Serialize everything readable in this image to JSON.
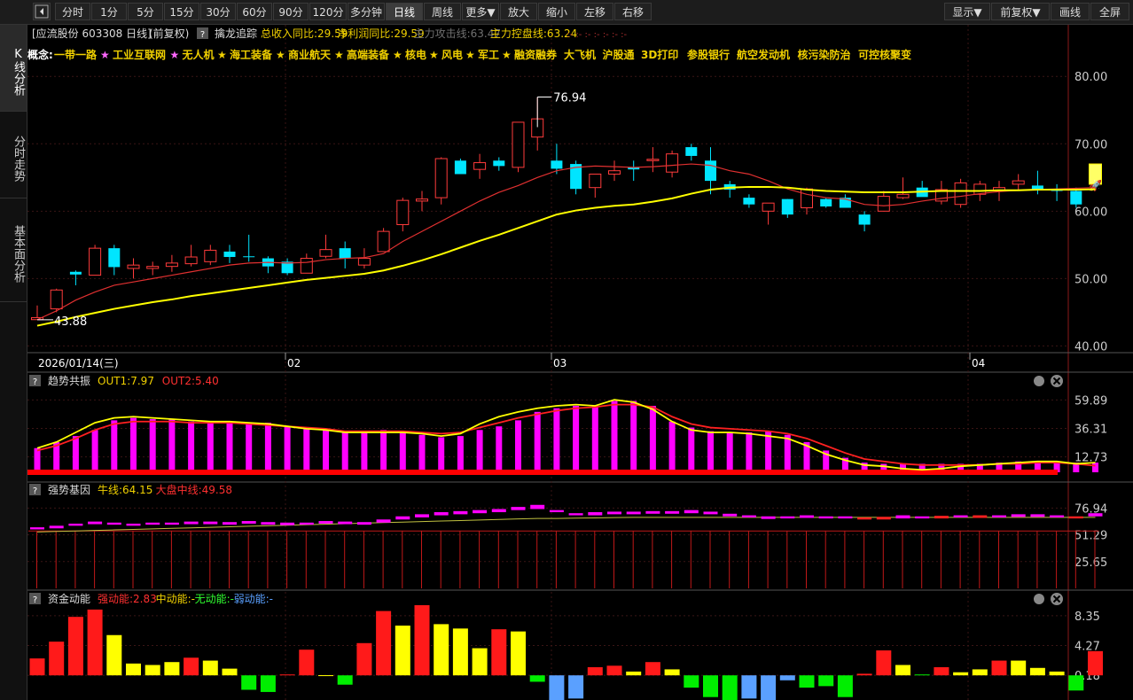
{
  "toolbar": {
    "back_icon": "back-arrow-icon",
    "left_buttons": [
      {
        "label": "分时",
        "w": 40
      },
      {
        "label": "1分",
        "w": 40
      },
      {
        "label": "5分",
        "w": 40
      },
      {
        "label": "15分",
        "w": 40
      },
      {
        "label": "30分",
        "w": 40
      },
      {
        "label": "60分",
        "w": 40
      },
      {
        "label": "90分",
        "w": 40
      },
      {
        "label": "120分",
        "w": 42
      },
      {
        "label": "多分钟",
        "w": 42
      },
      {
        "label": "日线",
        "w": 42,
        "active": true
      },
      {
        "label": "周线",
        "w": 42
      },
      {
        "label": "更多▼",
        "w": 42
      },
      {
        "label": "放大",
        "w": 42
      },
      {
        "label": "缩小",
        "w": 42
      },
      {
        "label": "左移",
        "w": 42
      },
      {
        "label": "右移",
        "w": 42
      }
    ],
    "right_buttons": [
      {
        "label": "显示▼",
        "w": 52
      },
      {
        "label": "前复权▼",
        "w": 66
      },
      {
        "label": "画线",
        "w": 44
      },
      {
        "label": "全屏",
        "w": 44
      }
    ]
  },
  "sidebar": [
    {
      "label": "K线分析",
      "active": true
    },
    {
      "label": "分时走势",
      "active": false
    },
    {
      "label": "基本面分析",
      "active": false
    }
  ],
  "main": {
    "title": "[应流股份 603308 日线]",
    "fq": "(前复权)",
    "indicator_name": "擒龙追踪",
    "metrics": [
      {
        "text": "总收入同比:29.59",
        "color": "#f0d000"
      },
      {
        "text": "净利润同比:29.59",
        "color": "#f0d000"
      },
      {
        "text": "主力攻击线:63.47",
        "color": "#707070"
      },
      {
        "text": "主力控盘线:63.24",
        "color": "#f0d000"
      }
    ],
    "trailing_marks": ":- :- :- :- :- :- :-",
    "concept_label": "概念:",
    "concepts": [
      {
        "name": "一带一路",
        "mark": "★",
        "mark_color": "#ff66ff"
      },
      {
        "name": "工业互联网",
        "mark": "★",
        "mark_color": "#ff66ff"
      },
      {
        "name": "无人机",
        "mark": "★",
        "mark_color": "#f0d000"
      },
      {
        "name": "海工装备",
        "mark": "★",
        "mark_color": "#f0d000"
      },
      {
        "name": "商业航天",
        "mark": "★",
        "mark_color": "#f0d000"
      },
      {
        "name": "高端装备",
        "mark": "★",
        "mark_color": "#f0d000"
      },
      {
        "name": "核电",
        "mark": "★",
        "mark_color": "#f0d000"
      },
      {
        "name": "风电",
        "mark": "★",
        "mark_color": "#f0d000"
      },
      {
        "name": "军工",
        "mark": "★",
        "mark_color": "#f0d000"
      },
      {
        "name": "融资融券",
        "mark": ""
      },
      {
        "name": "大飞机",
        "mark": ""
      },
      {
        "name": "沪股通",
        "mark": ""
      },
      {
        "name": "3D打印",
        "mark": ""
      },
      {
        "name": "参股银行",
        "mark": ""
      },
      {
        "name": "航空发动机",
        "mark": ""
      },
      {
        "name": "核污染防治",
        "mark": ""
      },
      {
        "name": "可控核聚变",
        "mark": ""
      }
    ],
    "high_label": "76.94",
    "low_label": "43.88",
    "date_label": "2026/01/14(三)",
    "month_labels": [
      "02",
      "03",
      "04"
    ]
  },
  "chart_data": {
    "type": "candlestick",
    "ylim": [
      39,
      87
    ],
    "y_ticks": [
      "80.00",
      "70.00",
      "60.00",
      "50.00",
      "40.00"
    ],
    "candles": [
      [
        43.9,
        46.0,
        43.9,
        44.2
      ],
      [
        45.5,
        48.5,
        45.0,
        48.3
      ],
      [
        51.0,
        51.2,
        49.0,
        50.6
      ],
      [
        50.5,
        55.0,
        50.5,
        54.5
      ],
      [
        54.5,
        55.0,
        50.5,
        51.7
      ],
      [
        51.5,
        53.0,
        50.0,
        52.0
      ],
      [
        51.5,
        52.5,
        50.5,
        51.8
      ],
      [
        51.8,
        53.5,
        51.0,
        52.3
      ],
      [
        52.2,
        55.0,
        51.8,
        53.2
      ],
      [
        52.5,
        55.0,
        52.0,
        54.2
      ],
      [
        54.0,
        55.0,
        52.3,
        53.2
      ],
      [
        53.3,
        56.5,
        52.5,
        53.2
      ],
      [
        53.0,
        53.3,
        50.8,
        51.8
      ],
      [
        52.5,
        53.0,
        50.5,
        50.8
      ],
      [
        50.8,
        53.7,
        50.8,
        53.0
      ],
      [
        53.3,
        56.5,
        53.0,
        54.3
      ],
      [
        54.5,
        55.5,
        51.5,
        53.0
      ],
      [
        52.0,
        54.5,
        51.5,
        53.0
      ],
      [
        54.0,
        57.5,
        54.0,
        57.0
      ],
      [
        58.0,
        62.0,
        57.0,
        61.6
      ],
      [
        61.5,
        63.0,
        60.0,
        61.8
      ],
      [
        62.0,
        68.0,
        61.0,
        67.8
      ],
      [
        67.5,
        67.8,
        65.5,
        65.5
      ],
      [
        66.2,
        68.5,
        64.8,
        67.2
      ],
      [
        67.5,
        68.0,
        66.0,
        66.7
      ],
      [
        66.5,
        72.5,
        65.8,
        73.2
      ],
      [
        71.0,
        76.9,
        69.0,
        73.7
      ],
      [
        67.5,
        70.0,
        65.5,
        66.3
      ],
      [
        67.0,
        67.5,
        62.5,
        63.3
      ],
      [
        63.5,
        65.5,
        62.0,
        65.5
      ],
      [
        65.5,
        67.5,
        64.5,
        66.0
      ],
      [
        66.5,
        67.5,
        64.5,
        66.2
      ],
      [
        67.5,
        69.5,
        65.8,
        67.7
      ],
      [
        65.8,
        69.0,
        65.0,
        68.5
      ],
      [
        69.5,
        70.0,
        67.5,
        68.2
      ],
      [
        67.5,
        69.5,
        62.5,
        64.5
      ],
      [
        64.0,
        64.5,
        62.0,
        63.2
      ],
      [
        62.0,
        62.5,
        60.5,
        61.0
      ],
      [
        60.0,
        60.5,
        58.0,
        61.2
      ],
      [
        61.8,
        61.8,
        59.0,
        59.5
      ],
      [
        60.5,
        63.5,
        59.5,
        63.3
      ],
      [
        61.8,
        62.0,
        60.5,
        60.7
      ],
      [
        62.0,
        62.5,
        60.5,
        60.5
      ],
      [
        59.5,
        60.0,
        57.0,
        58.0
      ],
      [
        60.0,
        63.0,
        60.0,
        62.2
      ],
      [
        62.0,
        65.0,
        61.8,
        62.5
      ],
      [
        63.5,
        64.5,
        62.5,
        62.1
      ],
      [
        61.5,
        64.5,
        61.0,
        63.2
      ],
      [
        61.0,
        64.8,
        60.5,
        64.2
      ],
      [
        62.5,
        64.5,
        61.5,
        64.0
      ],
      [
        63.0,
        64.5,
        61.5,
        63.5
      ],
      [
        64.0,
        65.5,
        63.0,
        64.5
      ],
      [
        63.8,
        66.0,
        62.5,
        63.2
      ],
      [
        63.3,
        64.0,
        61.5,
        63.0
      ],
      [
        63.0,
        63.5,
        60.5,
        61.0
      ],
      [
        64.0,
        67.0,
        63.5,
        67.0
      ]
    ],
    "ma_fast": [
      43.9,
      45.2,
      46.8,
      48.0,
      49.0,
      49.5,
      50.0,
      50.5,
      51.0,
      51.5,
      52.0,
      52.3,
      52.4,
      52.3,
      52.4,
      52.8,
      53.0,
      53.1,
      53.7,
      55.5,
      57.0,
      58.5,
      60.0,
      61.5,
      62.8,
      63.8,
      65.0,
      66.0,
      66.5,
      66.7,
      66.6,
      66.5,
      66.6,
      66.8,
      67.0,
      66.8,
      66.0,
      65.5,
      64.5,
      63.3,
      62.5,
      62.0,
      61.8,
      61.0,
      60.8,
      61.0,
      61.5,
      61.9,
      62.2,
      62.6,
      62.9,
      63.1,
      63.2,
      63.3,
      63.4,
      63.5
    ],
    "ma_slow": [
      43.0,
      43.6,
      44.3,
      44.9,
      45.5,
      46.0,
      46.5,
      46.9,
      47.4,
      47.8,
      48.2,
      48.6,
      49.0,
      49.4,
      49.8,
      50.1,
      50.4,
      50.7,
      51.2,
      51.9,
      52.7,
      53.6,
      54.6,
      55.6,
      56.5,
      57.5,
      58.5,
      59.5,
      60.1,
      60.5,
      60.8,
      61.0,
      61.4,
      61.9,
      62.6,
      63.2,
      63.5,
      63.6,
      63.6,
      63.5,
      63.2,
      63.0,
      62.9,
      62.8,
      62.8,
      62.8,
      62.9,
      63.0,
      63.0,
      63.0,
      63.1,
      63.1,
      63.2,
      63.2,
      63.2,
      63.24
    ],
    "sub1": {
      "name": "趋势共振",
      "out1": "OUT1:7.97",
      "out2": "OUT2:5.40",
      "ticks": [
        "59.89",
        "36.31",
        "12.73"
      ],
      "ylim": [
        0,
        66
      ],
      "bars": [
        20,
        25,
        30,
        35,
        43,
        45,
        44,
        44,
        42,
        42,
        42,
        41,
        41,
        38,
        37,
        36,
        33,
        33,
        35,
        33,
        31,
        29,
        30,
        35,
        38,
        43,
        50,
        53,
        55,
        55,
        59,
        59,
        55,
        42,
        37,
        34,
        33,
        33,
        34,
        31,
        25,
        18,
        12,
        8,
        7,
        7,
        7,
        7,
        7,
        7,
        8,
        9,
        9,
        9,
        8,
        8
      ],
      "line_out1": [
        20,
        25,
        33,
        41,
        45,
        46,
        45,
        44,
        43,
        42,
        42,
        41,
        40,
        38,
        36,
        35,
        33,
        33,
        33,
        33,
        32,
        30,
        32,
        40,
        46,
        50,
        53,
        55,
        56,
        55,
        60,
        58,
        52,
        42,
        35,
        33,
        33,
        32,
        30,
        28,
        22,
        15,
        10,
        6,
        5,
        3,
        2,
        3,
        5,
        6,
        7,
        8,
        9,
        9,
        7,
        7.97
      ],
      "line_out2": [
        18,
        22,
        28,
        35,
        40,
        42,
        42,
        42,
        41,
        41,
        41,
        40,
        39,
        38,
        37,
        36,
        34,
        34,
        34,
        34,
        33,
        32,
        33,
        37,
        41,
        45,
        48,
        51,
        53,
        54,
        56,
        56,
        54,
        46,
        40,
        37,
        36,
        35,
        34,
        32,
        28,
        22,
        16,
        11,
        9,
        7,
        6,
        6,
        6,
        6,
        7,
        7,
        8,
        8,
        7,
        5.4
      ]
    },
    "sub2": {
      "name": "强势基因",
      "niu": "牛线:64.15",
      "dapan": "大盘中线:49.58",
      "ticks": [
        "76.94",
        "51.29",
        "25.65"
      ],
      "ylim": [
        0,
        90
      ],
      "boxes": [
        [
          56.5,
          58.5
        ],
        [
          57.5,
          60
        ],
        [
          60,
          62
        ],
        [
          61.5,
          64
        ],
        [
          61,
          63
        ],
        [
          60,
          62
        ],
        [
          61,
          63
        ],
        [
          61,
          63
        ],
        [
          61.5,
          64
        ],
        [
          61.5,
          64
        ],
        [
          61,
          63.5
        ],
        [
          62,
          64.5
        ],
        [
          61,
          63.5
        ],
        [
          60.5,
          63
        ],
        [
          61,
          63
        ],
        [
          62,
          64.5
        ],
        [
          61.5,
          64
        ],
        [
          61,
          63.5
        ],
        [
          63,
          66
        ],
        [
          66,
          69
        ],
        [
          68,
          71
        ],
        [
          70,
          73
        ],
        [
          71,
          74
        ],
        [
          72,
          75
        ],
        [
          73,
          76
        ],
        [
          75,
          78
        ],
        [
          76,
          80
        ],
        [
          73,
          75
        ],
        [
          70,
          72
        ],
        [
          70,
          73
        ],
        [
          71,
          73.5
        ],
        [
          71,
          73.5
        ],
        [
          71.5,
          74
        ],
        [
          71.5,
          74
        ],
        [
          72,
          75
        ],
        [
          71,
          73.5
        ],
        [
          69,
          71.5
        ],
        [
          68,
          70
        ],
        [
          66.5,
          69
        ],
        [
          67,
          69
        ],
        [
          67.5,
          70
        ],
        [
          67,
          69
        ],
        [
          67,
          69
        ],
        [
          66,
          68
        ],
        [
          66,
          68.5
        ],
        [
          67,
          70
        ],
        [
          67,
          69
        ],
        [
          67,
          69.5
        ],
        [
          68,
          70
        ],
        [
          67.5,
          70
        ],
        [
          68,
          70
        ],
        [
          68.5,
          71
        ],
        [
          68.5,
          71
        ],
        [
          68,
          70
        ],
        [
          67,
          69
        ],
        [
          69,
          72
        ]
      ],
      "boxcolor": [
        "p",
        "p",
        "p",
        "p",
        "p",
        "p",
        "p",
        "p",
        "p",
        "p",
        "p",
        "p",
        "p",
        "p",
        "p",
        "p",
        "p",
        "p",
        "p",
        "p",
        "p",
        "p",
        "p",
        "p",
        "p",
        "p",
        "p",
        "p",
        "p",
        "p",
        "p",
        "p",
        "p",
        "p",
        "p",
        "p",
        "p",
        "p",
        "p",
        "p",
        "p",
        "p",
        "p",
        "r",
        "r",
        "p",
        "p",
        "r",
        "p",
        "r",
        "p",
        "p",
        "p",
        "p",
        "r",
        "p"
      ],
      "niu_line": [
        54,
        54.5,
        55,
        55.5,
        56,
        56.5,
        57,
        57.5,
        58,
        58.5,
        59,
        59.5,
        60,
        60.5,
        61,
        61.5,
        62,
        62.5,
        63,
        63.5,
        64,
        64.5,
        65,
        65.5,
        66,
        66.5,
        67,
        67,
        67.3,
        67.5,
        67.8,
        68,
        68,
        68,
        68,
        68,
        68,
        68,
        68,
        68,
        68,
        68,
        68,
        68,
        68,
        68,
        68,
        68,
        68,
        68,
        68,
        68,
        68,
        68,
        68,
        68
      ],
      "red_line": 55
    },
    "sub3": {
      "name": "资金动能",
      "strong": "强动能:2.83",
      "mid": "中动能:-",
      "none": "无动能:-",
      "weak": "弱动能:-",
      "ticks": [
        "8.35",
        "4.27",
        "0.18"
      ],
      "ylim": [
        -3.2,
        9.8
      ],
      "bars": [
        [
          2.5,
          "r"
        ],
        [
          4.8,
          "r"
        ],
        [
          8.2,
          "r"
        ],
        [
          9.2,
          "r"
        ],
        [
          5.7,
          "y"
        ],
        [
          1.8,
          "y"
        ],
        [
          1.6,
          "y"
        ],
        [
          2.0,
          "y"
        ],
        [
          2.6,
          "r"
        ],
        [
          2.2,
          "y"
        ],
        [
          1.1,
          "y"
        ],
        [
          -1.8,
          "g"
        ],
        [
          -2.1,
          "g"
        ],
        [
          0.3,
          "r"
        ],
        [
          3.7,
          "r"
        ],
        [
          0.2,
          "y"
        ],
        [
          -1.1,
          "g"
        ],
        [
          4.6,
          "r"
        ],
        [
          9.0,
          "r"
        ],
        [
          7.0,
          "y"
        ],
        [
          9.8,
          "r"
        ],
        [
          7.2,
          "y"
        ],
        [
          6.6,
          "y"
        ],
        [
          3.9,
          "y"
        ],
        [
          6.5,
          "r"
        ],
        [
          6.2,
          "y"
        ],
        [
          -0.7,
          "g"
        ],
        [
          -3.2,
          "b"
        ],
        [
          -3.0,
          "b"
        ],
        [
          1.3,
          "r"
        ],
        [
          1.5,
          "r"
        ],
        [
          0.7,
          "y"
        ],
        [
          2.0,
          "r"
        ],
        [
          1.0,
          "y"
        ],
        [
          -1.5,
          "g"
        ],
        [
          -2.8,
          "g"
        ],
        [
          -3.5,
          "g"
        ],
        [
          -3.0,
          "b"
        ],
        [
          -3.2,
          "b"
        ],
        [
          -0.5,
          "b"
        ],
        [
          -1.5,
          "g"
        ],
        [
          -1.3,
          "g"
        ],
        [
          -2.8,
          "g"
        ],
        [
          0.4,
          "r"
        ],
        [
          3.6,
          "r"
        ],
        [
          1.6,
          "y"
        ],
        [
          0.3,
          "g"
        ],
        [
          1.3,
          "r"
        ],
        [
          0.6,
          "y"
        ],
        [
          1.0,
          "y"
        ],
        [
          2.2,
          "r"
        ],
        [
          2.2,
          "y"
        ],
        [
          1.2,
          "y"
        ],
        [
          0.7,
          "y"
        ],
        [
          -1.9,
          "g"
        ],
        [
          3.5,
          "r"
        ]
      ]
    }
  }
}
